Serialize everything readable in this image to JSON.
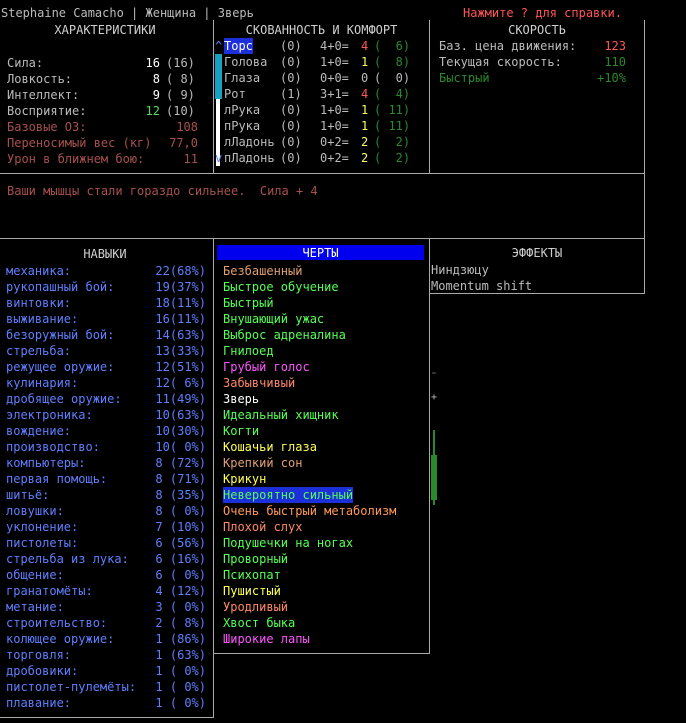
{
  "title_bar": {
    "text": "Stephaine Camacho | Женщина | Зверь",
    "help": "Нажмите ? для справки."
  },
  "characteristics": {
    "header": "ХАРАКТЕРИСТИКИ",
    "rows": [
      {
        "label": "Сила:",
        "value": "16",
        "base": "(16)",
        "color": "#ffffff"
      },
      {
        "label": "Ловкость:",
        "value": "8",
        "base": "( 8)",
        "color": "#ffffff"
      },
      {
        "label": "Интеллект:",
        "value": "9",
        "base": "( 9)",
        "color": "#ffffff"
      },
      {
        "label": "Восприятие:",
        "value": "12",
        "base": "(10)",
        "color": "#55dd55"
      }
    ],
    "extra": [
      {
        "label": "Базовые ОЗ:",
        "value": "108"
      },
      {
        "label": "Переносимый вес (кг)",
        "value": "77,0"
      },
      {
        "label": "Урон в ближнем бою:",
        "value": "11"
      }
    ]
  },
  "encumbrance": {
    "header": "СКОВАННОСТЬ И КОМФОРТ",
    "rows": [
      {
        "mark": "^",
        "part": "Торс",
        "enc": "(0)",
        "formula": "4+0=",
        "total": "4",
        "comfort": "(  6)",
        "part_color": "#5f7fff",
        "highlight": true,
        "total_color": "#ff5555",
        "comfort_color": "#2a8a2a"
      },
      {
        "mark": " ",
        "part": "Голова",
        "enc": "(0)",
        "formula": "1+0=",
        "total": "1",
        "comfort": "(  8)",
        "part_color": "#bbbbbb",
        "highlight": false,
        "total_color": "#ffff55",
        "comfort_color": "#2a8a2a"
      },
      {
        "mark": " ",
        "part": "Глаза",
        "enc": "(0)",
        "formula": "0+0=",
        "total": "0",
        "comfort": "(  0)",
        "part_color": "#bbbbbb",
        "highlight": false,
        "total_color": "#bbbbbb",
        "comfort_color": "#bbbbbb"
      },
      {
        "mark": " ",
        "part": "Рот",
        "enc": "(1)",
        "formula": "3+1=",
        "total": "4",
        "comfort": "(  4)",
        "part_color": "#bbbbbb",
        "highlight": false,
        "total_color": "#ff5555",
        "comfort_color": "#2a8a2a"
      },
      {
        "mark": " ",
        "part": "лРука",
        "enc": "(0)",
        "formula": "1+0=",
        "total": "1",
        "comfort": "( 11)",
        "part_color": "#bbbbbb",
        "highlight": false,
        "total_color": "#ffff55",
        "comfort_color": "#2a8a2a"
      },
      {
        "mark": " ",
        "part": "пРука",
        "enc": "(0)",
        "formula": "1+0=",
        "total": "1",
        "comfort": "( 11)",
        "part_color": "#bbbbbb",
        "highlight": false,
        "total_color": "#ffff55",
        "comfort_color": "#2a8a2a"
      },
      {
        "mark": " ",
        "part": "лЛадонь",
        "enc": "(0)",
        "formula": "0+2=",
        "total": "2",
        "comfort": "(  2)",
        "part_color": "#bbbbbb",
        "highlight": false,
        "total_color": "#ffff55",
        "comfort_color": "#2a8a2a"
      },
      {
        "mark": "v",
        "part": "пЛадонь",
        "enc": "(0)",
        "formula": "0+2=",
        "total": "2",
        "comfort": "(  2)",
        "part_color": "#bbbbbb",
        "highlight": false,
        "total_color": "#ffff55",
        "comfort_color": "#2a8a2a"
      }
    ]
  },
  "speed": {
    "header": "СКОРОСТЬ",
    "rows": [
      {
        "label": "Баз. цена движения:",
        "value": "123",
        "label_color": "#bbbbbb",
        "value_color": "#ff5555"
      },
      {
        "label": "Текущая скорость:",
        "value": "110",
        "label_color": "#bbbbbb",
        "value_color": "#2a8a2a"
      },
      {
        "label": "Быстрый",
        "value": "+10%",
        "label_color": "#2a8a2a",
        "value_color": "#2a8a2a"
      }
    ]
  },
  "message": "Ваши мышцы стали гораздо сильнее.  Сила + 4",
  "skills": {
    "header": "НАВЫКИ",
    "rows": [
      {
        "name": "механика:",
        "value": "22(68%)"
      },
      {
        "name": "рукопашный бой:",
        "value": "19(37%)"
      },
      {
        "name": "винтовки:",
        "value": "18(11%)"
      },
      {
        "name": "выживание:",
        "value": "16(11%)"
      },
      {
        "name": "безоружный бой:",
        "value": "14(63%)"
      },
      {
        "name": "стрельба:",
        "value": "13(33%)"
      },
      {
        "name": "режущее оружие:",
        "value": "12(51%)"
      },
      {
        "name": "кулинария:",
        "value": "12( 6%)"
      },
      {
        "name": "дробящее оружие:",
        "value": "11(49%)"
      },
      {
        "name": "электроника:",
        "value": "10(63%)"
      },
      {
        "name": "вождение:",
        "value": "10(30%)"
      },
      {
        "name": "производство:",
        "value": "10( 0%)"
      },
      {
        "name": "компьютеры:",
        "value": "8 (72%)"
      },
      {
        "name": "первая помощь:",
        "value": "8 (71%)"
      },
      {
        "name": "шитьё:",
        "value": "8 (35%)"
      },
      {
        "name": "ловушки:",
        "value": "8 ( 0%)"
      },
      {
        "name": "уклонение:",
        "value": "7 (10%)"
      },
      {
        "name": "пистолеты:",
        "value": "6 (56%)"
      },
      {
        "name": "стрельба из лука:",
        "value": "6 (16%)"
      },
      {
        "name": "общение:",
        "value": "6 ( 0%)"
      },
      {
        "name": "гранатомёты:",
        "value": "4 (12%)"
      },
      {
        "name": "метание:",
        "value": "3 ( 0%)"
      },
      {
        "name": "строительство:",
        "value": "2 ( 8%)"
      },
      {
        "name": "колющее оружие:",
        "value": "1 (86%)"
      },
      {
        "name": "торговля:",
        "value": "1 (63%)"
      },
      {
        "name": "дробовики:",
        "value": "1 ( 0%)"
      },
      {
        "name": "пистолет-пулемёты:",
        "value": "1 ( 0%)"
      },
      {
        "name": "плавание:",
        "value": "1 ( 0%)"
      }
    ]
  },
  "traits": {
    "header": "ЧЕРТЫ",
    "rows": [
      {
        "name": "Безбашенный",
        "color": "#e0a070",
        "selected": false
      },
      {
        "name": "Быстрое обучение",
        "color": "#55ff55",
        "selected": false
      },
      {
        "name": "Быстрый",
        "color": "#55ff55",
        "selected": false
      },
      {
        "name": "Внушающий ужас",
        "color": "#55ff55",
        "selected": false
      },
      {
        "name": "Выброс адреналина",
        "color": "#55ff55",
        "selected": false
      },
      {
        "name": "Гнилоед",
        "color": "#55ff55",
        "selected": false
      },
      {
        "name": "Грубый голос",
        "color": "#ff55ff",
        "selected": false
      },
      {
        "name": "Забывчивый",
        "color": "#ff8866",
        "selected": false
      },
      {
        "name": "Зверь",
        "color": "#ffffff",
        "selected": false
      },
      {
        "name": "Идеальный хищник",
        "color": "#55ff55",
        "selected": false
      },
      {
        "name": "Когти",
        "color": "#55ff55",
        "selected": false
      },
      {
        "name": "Кошачьи глаза",
        "color": "#ffff55",
        "selected": false
      },
      {
        "name": "Крепкий сон",
        "color": "#e0a070",
        "selected": false
      },
      {
        "name": "Крикун",
        "color": "#ffff55",
        "selected": false
      },
      {
        "name": "Невероятно сильный",
        "color": "#55ff55",
        "selected": true
      },
      {
        "name": "Очень быстрый метаболизм",
        "color": "#ff9955",
        "selected": false
      },
      {
        "name": "Плохой слух",
        "color": "#ff8866",
        "selected": false
      },
      {
        "name": "Подушечки на ногах",
        "color": "#55ff55",
        "selected": false
      },
      {
        "name": "Проворный",
        "color": "#55ff55",
        "selected": false
      },
      {
        "name": "Психопат",
        "color": "#55ff55",
        "selected": false
      },
      {
        "name": "Пушистый",
        "color": "#ffff55",
        "selected": false
      },
      {
        "name": "Уродливый",
        "color": "#ff8866",
        "selected": false
      },
      {
        "name": "Хвост быка",
        "color": "#55ff55",
        "selected": false
      },
      {
        "name": "Широкие лапы",
        "color": "#ff55ff",
        "selected": false
      }
    ]
  },
  "effects": {
    "header": "ЭФФЕКТЫ",
    "rows": [
      "Ниндзюцу",
      "Momentum shift"
    ]
  },
  "colors": {
    "header_highlight": "#0000ee",
    "selection": "#1c2fd8",
    "scroll_track": "#2a8a2a"
  }
}
